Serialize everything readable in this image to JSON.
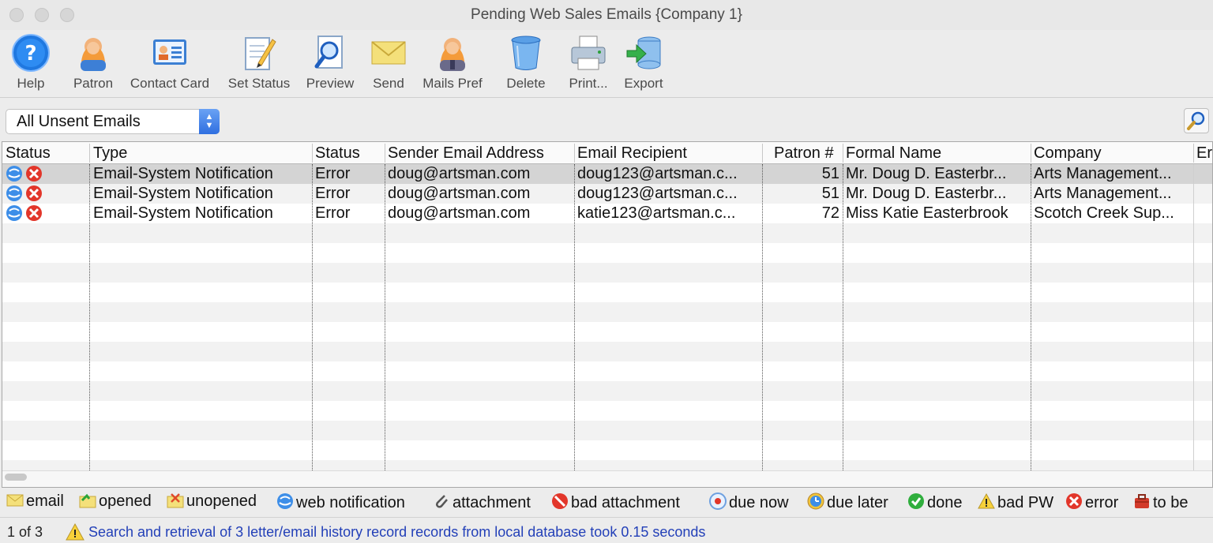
{
  "window": {
    "title": "Pending Web Sales Emails {Company 1}"
  },
  "toolbar": {
    "help": "Help",
    "patron": "Patron",
    "contact_card": "Contact Card",
    "set_status": "Set Status",
    "preview": "Preview",
    "send": "Send",
    "mails_pref": "Mails Pref",
    "delete": "Delete",
    "print": "Print...",
    "export": "Export"
  },
  "filter": {
    "selected": "All Unsent Emails"
  },
  "table": {
    "columns": {
      "status_icon": "Status",
      "type": "Type",
      "status": "Status",
      "sender": "Sender Email Address",
      "recipient": "Email Recipient",
      "patron_no": "Patron #",
      "formal_name": "Formal Name",
      "company": "Company",
      "overflow": "Er"
    },
    "rows": [
      {
        "type": "Email-System Notification",
        "status": "Error",
        "sender": "doug@artsman.com",
        "recipient": "doug123@artsman.c...",
        "patron_no": "51",
        "formal_name": "Mr. Doug D. Easterbr...",
        "company": "Arts Management..."
      },
      {
        "type": "Email-System Notification",
        "status": "Error",
        "sender": "doug@artsman.com",
        "recipient": "doug123@artsman.c...",
        "patron_no": "51",
        "formal_name": "Mr. Doug D. Easterbr...",
        "company": "Arts Management..."
      },
      {
        "type": "Email-System Notification",
        "status": "Error",
        "sender": "doug@artsman.com",
        "recipient": "katie123@artsman.c...",
        "patron_no": "72",
        "formal_name": "Miss Katie Easterbrook",
        "company": "Scotch Creek Sup..."
      }
    ]
  },
  "legend": {
    "email": "email",
    "opened": "opened",
    "unopened": "unopened",
    "web_notification": "web notification",
    "attachment": "attachment",
    "bad_attachment": "bad attachment",
    "due_now": "due now",
    "due_later": "due later",
    "done": "done",
    "bad_pw": "bad PW",
    "error": "error",
    "to_be": "to be"
  },
  "status_bar": {
    "count": "1 of 3",
    "message": "Search and retrieval of 3 letter/email history record records from local database took 0.15 seconds"
  }
}
